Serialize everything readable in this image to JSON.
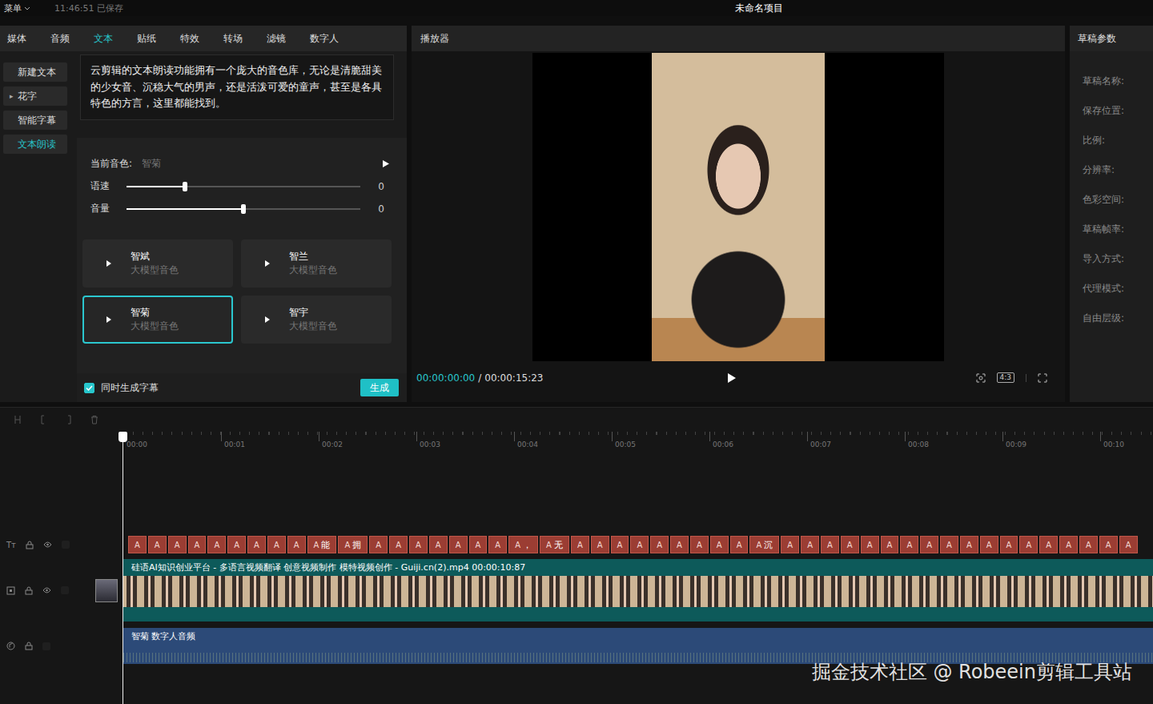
{
  "topbar": {
    "menu": "菜单",
    "time": "11:46:51",
    "status": "已保存",
    "title": "未命名项目"
  },
  "tabs": [
    {
      "label": "媒体",
      "selected": false
    },
    {
      "label": "音频",
      "selected": false
    },
    {
      "label": "文本",
      "selected": true
    },
    {
      "label": "贴纸",
      "selected": false
    },
    {
      "label": "特效",
      "selected": false
    },
    {
      "label": "转场",
      "selected": false
    },
    {
      "label": "滤镜",
      "selected": false
    },
    {
      "label": "数字人",
      "selected": false
    }
  ],
  "subnav": [
    {
      "label": "新建文本",
      "prefix": "",
      "selected": false
    },
    {
      "label": "花字",
      "prefix": "▸",
      "selected": false
    },
    {
      "label": "智能字幕",
      "prefix": "",
      "selected": false
    },
    {
      "label": "文本朗读",
      "prefix": "",
      "selected": true
    }
  ],
  "intro": "云剪辑的文本朗读功能拥有一个庞大的音色库，无论是清脆甜美的少女音、沉稳大气的男声，还是活泼可爱的童声，甚至是各具特色的方言，这里都能找到。",
  "current_voice": {
    "label": "当前音色:",
    "value": "智菊"
  },
  "sliders": [
    {
      "label": "语速",
      "level": 0.25,
      "reading": "0"
    },
    {
      "label": "音量",
      "level": 0.5,
      "reading": "0"
    }
  ],
  "voices": [
    {
      "name": "智斌",
      "desc": "大模型音色",
      "selected": false
    },
    {
      "name": "智兰",
      "desc": "大模型音色",
      "selected": false
    },
    {
      "name": "智菊",
      "desc": "大模型音色",
      "selected": true
    },
    {
      "name": "智宇",
      "desc": "大模型音色",
      "selected": false
    }
  ],
  "subtitle_option": {
    "label": "同时生成字幕",
    "checked": true
  },
  "generate_button": "生成",
  "player": {
    "title": "播放器",
    "current": "00:00:00:00",
    "separator": "/",
    "total": "00:00:15:23",
    "ratio": "4:3"
  },
  "params": {
    "title": "草稿参数",
    "fields": [
      "草稿名称:",
      "保存位置:",
      "比例:",
      "分辨率:",
      "色彩空间:",
      "草稿帧率:",
      "导入方式:",
      "代理模式:",
      "自由层级:"
    ]
  },
  "timeline": {
    "ticks": [
      "00:00",
      "00:01",
      "00:02",
      "00:03",
      "00:04",
      "00:05",
      "00:06",
      "00:07",
      "00:08",
      "00:09",
      "00:10"
    ],
    "text_track_icon": "Tт",
    "clip_icon": "A",
    "clips": [
      "",
      "",
      "",
      "",
      "",
      "",
      "",
      "",
      "",
      "能",
      "拥",
      "",
      "",
      "",
      "",
      "",
      "",
      "",
      "，",
      "无",
      "",
      "",
      "",
      "",
      "",
      "",
      "",
      "",
      "",
      "沉",
      "",
      "",
      "",
      "",
      "",
      "",
      "",
      "",
      "",
      "",
      "",
      "",
      "",
      "",
      "",
      "",
      "",
      ""
    ],
    "video_clip": "硅语AI知识创业平台 - 多语言视频翻译 创意视频制作 模特视频创作 - Guiji.cn(2).mp4 00:00:10:87",
    "audio_clip": "智菊 数字人音频"
  },
  "watermark": "掘金技术社区 @ Robeein剪辑工具站"
}
